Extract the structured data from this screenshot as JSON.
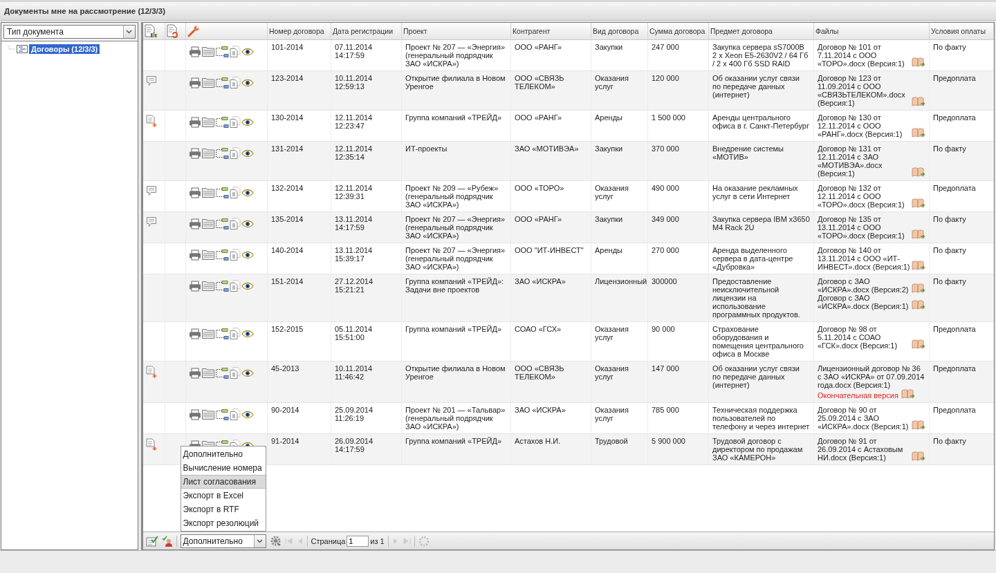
{
  "window": {
    "title": "Документы мне на рассмотрение (12/3/3)"
  },
  "sidebar": {
    "filter": {
      "value": "Тип документа"
    },
    "tree": [
      {
        "label": "Договоры (12/3/3)",
        "selected": true
      }
    ]
  },
  "table": {
    "columns": [
      "Номер договора",
      "Дата регистрации",
      "Проект",
      "Контрагент",
      "Вид договора",
      "Сумма договора",
      "Предмет договора",
      "Файлы",
      "Условия оплаты"
    ],
    "rows": [
      {
        "has_comment": false,
        "is_new": false,
        "number": "101-2014",
        "date": "07.11.2014",
        "time": "14:17:59",
        "project": "Проект № 207 — «Энергия» (генеральный подрядчик ЗАО «ИСКРА»)",
        "counterparty": "ООО «РАНГ»",
        "type": "Закупки",
        "sum": "247 000",
        "subject": "Закупка сервера sS7000B 2 x Xeon E5-2630V2 / 64 Гб / 2 x 400 Гб SSD RAID",
        "files": [
          {
            "name": "Договор № 101 от 7.11.2014 с ООО «ТОРО».docx (Версия:1)"
          }
        ],
        "terms": "По факту"
      },
      {
        "has_comment": true,
        "is_new": false,
        "number": "123-2014",
        "date": "10.11.2014",
        "time": "12:59:13",
        "project": "Открытие филиала в Новом Уренгое",
        "counterparty": "ООО «СВЯЗЬ ТЕЛЕКОМ»",
        "type": "Оказания услуг",
        "sum": "120 000",
        "subject": "Об оказании услуг связи по передаче данных (интернет)",
        "files": [
          {
            "name": "Договор № 123 от 11.09.2014 с ООО «СВЯЗЬТЕЛЕКОМ».docx (Версия:1)"
          }
        ],
        "terms": "Предоплата"
      },
      {
        "has_comment": false,
        "is_new": true,
        "number": "130-2014",
        "date": "12.11.2014",
        "time": "12:23:47",
        "project": "Группа компаний «ТРЕЙД»",
        "counterparty": "ООО «РАНГ»",
        "type": "Аренды",
        "sum": "1 500 000",
        "subject": "Аренды центрального офиса в г. Санкт-Петербург",
        "files": [
          {
            "name": "Договор № 130 от 12.11.2014 с ООО «РАНГ».docx (Версия:1)"
          }
        ],
        "terms": "Предоплата"
      },
      {
        "has_comment": false,
        "is_new": false,
        "number": "131-2014",
        "date": "12.11.2014",
        "time": "12:35:14",
        "project": "ИТ-проекты",
        "counterparty": "ЗАО «МОТИВЭА»",
        "type": "Закупки",
        "sum": "370 000",
        "subject": "Внедрение системы «МОТИВ»",
        "files": [
          {
            "name": "Договор № 131 от 12.11.2014 с ЗАО «МОТИВЭА».docx (Версия:1)"
          }
        ],
        "terms": "По факту"
      },
      {
        "has_comment": true,
        "is_new": false,
        "number": "132-2014",
        "date": "12.11.2014",
        "time": "12:39:31",
        "project": "Проект № 209 — «Рубеж» (генеральный подрядчик ЗАО «ИСКРА»)",
        "counterparty": "ООО «ТОРО»",
        "type": "Оказания услуг",
        "sum": "490 000",
        "subject": "На оказание рекламных услуг в сети Интернет",
        "files": [
          {
            "name": "Договор № 132 от 12.11.2014 с ООО «ТОРО».docx (Версия:1)"
          }
        ],
        "terms": "Предоплата"
      },
      {
        "has_comment": true,
        "is_new": false,
        "number": "135-2014",
        "date": "13.11.2014",
        "time": "14:17:59",
        "project": "Проект № 207 — «Энергия» (генеральный подрядчик ЗАО «ИСКРА»)",
        "counterparty": "ООО «РАНГ»",
        "type": "Закупки",
        "sum": "349 000",
        "subject": "Закупка сервера IBM x3650 M4 Rack 2U",
        "files": [
          {
            "name": "Договор № 135 от 13.11.2014 с ООО «ТОРО».docx (Версия:1)"
          }
        ],
        "terms": "По факту"
      },
      {
        "has_comment": false,
        "is_new": false,
        "number": "140-2014",
        "date": "13.11.2014",
        "time": "15:39:17",
        "project": "Проект № 207 — «Энергия» (генеральный подрядчик ЗАО «ИСКРА»)",
        "counterparty": "ООО \"ИТ-ИНВЕСТ\"",
        "type": "Аренды",
        "sum": "270 000",
        "subject": "Аренда выделенного сервера в дата-центре «Дубровка»",
        "files": [
          {
            "name": "Договор № 140 от 13.11.2014 с ООО «ИТ-ИНВЕСТ».docx (Версия:1)"
          }
        ],
        "terms": "По факту"
      },
      {
        "has_comment": false,
        "is_new": false,
        "number": "151-2014",
        "date": "27.12.2014",
        "time": "15:21:21",
        "project": "Группа компаний «ТРЕЙД»: Задачи вне проектов",
        "counterparty": "ЗАО «ИСКРА»",
        "type": "Лицензионный",
        "sum": "300000",
        "subject": "Предоставление неисключительной лицензии на использование программных продуктов.",
        "files": [
          {
            "name": "Договор с ЗАО «ИСКРА».docx (Версия:2)"
          },
          {
            "name": "Договор с ЗАО «ИСКРА».docx (Версия:1)"
          }
        ],
        "terms": "По факту"
      },
      {
        "has_comment": false,
        "is_new": false,
        "number": "152-2015",
        "date": "05.11.2014",
        "time": "15:51:00",
        "project": "Группа компаний «ТРЕЙД»",
        "counterparty": "СОАО «ГСХ»",
        "type": "Оказания услуг",
        "sum": "90 000",
        "subject": "Страхование оборудования и помещения центрального офиса в Москве",
        "files": [
          {
            "name": "Договор № 98 от 5.11.2014 с СОАО «ГСК».docx (Версия:1)"
          }
        ],
        "terms": "Предоплата"
      },
      {
        "has_comment": false,
        "is_new": true,
        "number": "45-2013",
        "date": "10.11.2014",
        "time": "11:46:42",
        "project": "Открытие филиала в Новом Уренгое",
        "counterparty": "ООО «СВЯЗЬ ТЕЛЕКОМ»",
        "type": "Оказания услуг",
        "sum": "147 000",
        "subject": "Об оказании услуг связи по передаче данных (интернет)",
        "files": [
          {
            "name": "Лицензионный договор № 36 с ЗАО «ИСКРА» от 07.09.2014 года.docx (Версия:1)",
            "note": "Окончательная версия"
          }
        ],
        "terms": "Предоплата"
      },
      {
        "has_comment": false,
        "is_new": false,
        "number": "90-2014",
        "date": "25.09.2014",
        "time": "11:26:19",
        "project": "Проект № 201 — «Тальвар» (генеральный подрядчик ЗАО «ИСКРА»)",
        "counterparty": "ЗАО «ИСКРА»",
        "type": "Оказания услуг",
        "sum": "785 000",
        "subject": "Техническая поддержка пользователей по телефону и через интернет",
        "files": [
          {
            "name": "Договор № 90 от 25.09.2014 с ЗАО «ИСКРА».docx (Версия:1)"
          }
        ],
        "terms": "Предоплата"
      },
      {
        "has_comment": false,
        "is_new": true,
        "number": "91-2014",
        "date": "26.09.2014",
        "time": "14:17:59",
        "project": "Группа компаний «ТРЕЙД»",
        "counterparty": "Астахов Н.И.",
        "type": "Трудовой",
        "sum": "5 900 000",
        "subject": "Трудовой договор с директором по продажам ЗАО «КАМЕРОН»",
        "files": [
          {
            "name": "Договор № 91 от 26.09.2014 с Астаховым НИ.docx (Версия:1)"
          }
        ],
        "terms": "По факту"
      }
    ]
  },
  "menu": {
    "items": [
      {
        "label": "Дополнительно",
        "selected": false
      },
      {
        "label": "Вычисление номера",
        "selected": false
      },
      {
        "label": "Лист согласования",
        "selected": true
      },
      {
        "label": "Экспорт в Excel",
        "selected": false
      },
      {
        "label": "Экспорт в RTF",
        "selected": false
      },
      {
        "label": "Экспорт резолюций",
        "selected": false
      }
    ]
  },
  "pager": {
    "action": "Дополнительно",
    "page_label": "Страница",
    "page": "1",
    "total": "из 1"
  }
}
